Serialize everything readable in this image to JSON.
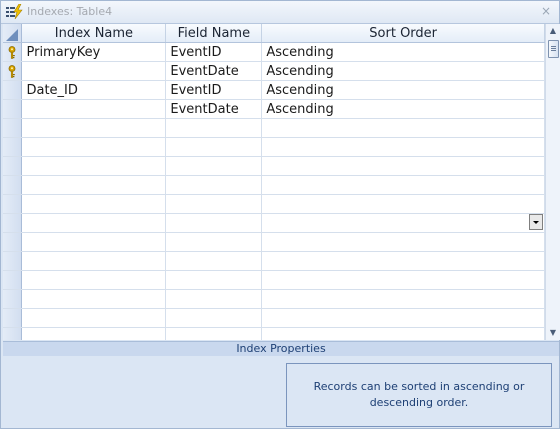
{
  "window": {
    "title": "Indexes: Table4",
    "close": "×"
  },
  "grid": {
    "columns": [
      "Index Name",
      "Field Name",
      "Sort Order"
    ],
    "rows": [
      {
        "primary_key": true,
        "index_name": "PrimaryKey",
        "field_name": "EventID",
        "sort_order": "Ascending"
      },
      {
        "primary_key": true,
        "index_name": "",
        "field_name": "EventDate",
        "sort_order": "Ascending"
      },
      {
        "primary_key": false,
        "index_name": "Date_ID",
        "field_name": "EventID",
        "sort_order": "Ascending"
      },
      {
        "primary_key": false,
        "index_name": "",
        "field_name": "EventDate",
        "sort_order": "Ascending"
      },
      {
        "primary_key": false,
        "index_name": "",
        "field_name": "",
        "sort_order": ""
      },
      {
        "primary_key": false,
        "index_name": "",
        "field_name": "",
        "sort_order": ""
      },
      {
        "primary_key": false,
        "index_name": "",
        "field_name": "",
        "sort_order": ""
      },
      {
        "primary_key": false,
        "index_name": "",
        "field_name": "",
        "sort_order": ""
      },
      {
        "primary_key": false,
        "index_name": "",
        "field_name": "",
        "sort_order": ""
      },
      {
        "primary_key": false,
        "index_name": "",
        "field_name": "",
        "sort_order": ""
      },
      {
        "primary_key": false,
        "index_name": "",
        "field_name": "",
        "sort_order": ""
      },
      {
        "primary_key": false,
        "index_name": "",
        "field_name": "",
        "sort_order": ""
      },
      {
        "primary_key": false,
        "index_name": "",
        "field_name": "",
        "sort_order": ""
      },
      {
        "primary_key": false,
        "index_name": "",
        "field_name": "",
        "sort_order": ""
      },
      {
        "primary_key": false,
        "index_name": "",
        "field_name": "",
        "sort_order": ""
      },
      {
        "primary_key": false,
        "index_name": "",
        "field_name": "",
        "sort_order": ""
      }
    ]
  },
  "properties": {
    "header": "Index Properties",
    "help_text": "Records can be sorted in ascending or descending order."
  },
  "icons": {
    "title": "indexes-lightning-icon",
    "key": "primary-key-icon"
  },
  "colors": {
    "accent": "#1d3f74",
    "background": "#dbe6f4",
    "key": "#d9a400"
  }
}
